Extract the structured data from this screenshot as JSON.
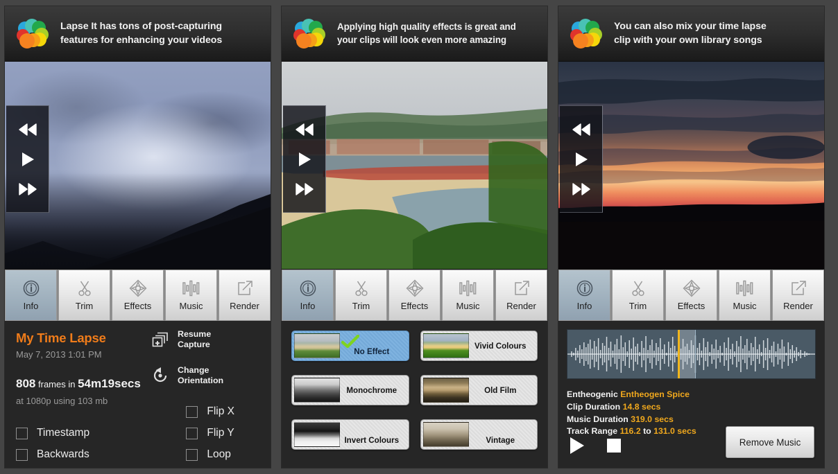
{
  "app": {
    "name": "Lapse It",
    "logo_icon": "lapse-it-flower-logo"
  },
  "panels": [
    {
      "id": "info",
      "banner": {
        "text_html": "<b>Lapse It</b> has <b>tons</b> of <b>post-capturing<br><b>features</b> for <b>enhancing</b> your <b>videos</b>"
      },
      "banner_line1": "Lapse It has tons of post-capturing",
      "banner_line2": "features for enhancing your videos",
      "video": {
        "scene": "stormy-blue-mountain-clouds"
      },
      "playback": {
        "rewind": "rewind-icon",
        "play": "play-icon",
        "forward": "fast-forward-icon"
      },
      "toolbar": {
        "active": "Info",
        "tabs": [
          {
            "label": "Info",
            "icon": "info-circle-icon"
          },
          {
            "label": "Trim",
            "icon": "scissors-icon"
          },
          {
            "label": "Effects",
            "icon": "compass-star-icon"
          },
          {
            "label": "Music",
            "icon": "equalizer-bars-icon"
          },
          {
            "label": "Render",
            "icon": "export-arrow-icon"
          }
        ]
      },
      "info": {
        "project_title": "My Time Lapse",
        "date": "May 7, 2013 1:01 PM",
        "frame_count": "808",
        "frames_word": "frames in",
        "duration": "54m19secs",
        "resolution_line": "at 1080p using 103 mb",
        "actions": [
          {
            "icon": "add-frames-icon",
            "line1": "Resume",
            "line2": "Capture"
          },
          {
            "icon": "rotate-orientation-icon",
            "line1": "Change",
            "line2": "Orientation"
          }
        ],
        "checkboxes_left": [
          {
            "label": "Timestamp",
            "checked": false
          },
          {
            "label": "Backwards",
            "checked": false
          }
        ],
        "checkboxes_right": [
          {
            "label": "Flip X",
            "checked": false
          },
          {
            "label": "Flip Y",
            "checked": false
          },
          {
            "label": "Loop",
            "checked": false
          }
        ]
      }
    },
    {
      "id": "effects",
      "banner_line1": "Applying high quality effects is great and",
      "banner_line2": "your clips will look even more amazing",
      "video": {
        "scene": "coastal-town-beach"
      },
      "toolbar": {
        "active": "Effects",
        "tabs": [
          {
            "label": "Info",
            "icon": "info-circle-icon"
          },
          {
            "label": "Trim",
            "icon": "scissors-icon"
          },
          {
            "label": "Effects",
            "icon": "compass-star-icon"
          },
          {
            "label": "Music",
            "icon": "equalizer-bars-icon"
          },
          {
            "label": "Render",
            "icon": "export-arrow-icon"
          }
        ]
      },
      "effects": [
        {
          "label": "No Effect",
          "selected": true,
          "thumb": "th-coast"
        },
        {
          "label": "Vivid Colours",
          "selected": false,
          "thumb": "th-vivid"
        },
        {
          "label": "Monochrome",
          "selected": false,
          "thumb": "th-mono"
        },
        {
          "label": "Old Film",
          "selected": false,
          "thumb": "th-old"
        },
        {
          "label": "Invert Colours",
          "selected": false,
          "thumb": "th-inv"
        },
        {
          "label": "Vintage",
          "selected": false,
          "thumb": "th-vint"
        }
      ],
      "selected_icon": "green-check-icon"
    },
    {
      "id": "music",
      "banner_line1": "You can also mix your time lapse",
      "banner_line2": "clip with your own library songs",
      "video": {
        "scene": "sunset-sky"
      },
      "toolbar": {
        "active": "Info",
        "tabs": [
          {
            "label": "Info",
            "icon": "info-circle-icon"
          },
          {
            "label": "Trim",
            "icon": "scissors-icon"
          },
          {
            "label": "Effects",
            "icon": "compass-star-icon"
          },
          {
            "label": "Music",
            "icon": "equalizer-bars-icon"
          },
          {
            "label": "Render",
            "icon": "export-arrow-icon"
          }
        ]
      },
      "music": {
        "waveform_icon": "audio-waveform",
        "artist": "Entheogenic",
        "track": "Entheogen Spice",
        "clip_duration_label": "Clip Duration",
        "clip_duration_value": "14.8 secs",
        "music_duration_label": "Music Duration",
        "music_duration_value": "319.0 secs",
        "track_range_label": "Track Range",
        "track_range_from": "116.2",
        "track_range_to_word": "to",
        "track_range_to": "131.0 secs",
        "play_icon": "play-icon",
        "stop_icon": "stop-icon",
        "remove_button": "Remove Music"
      }
    }
  ],
  "colors": {
    "accent_orange": "#f07c1a",
    "amber": "#f0a81d",
    "selection_blue": "#7fb3e0",
    "panel_bg": "#262626",
    "app_bg": "#454545"
  }
}
